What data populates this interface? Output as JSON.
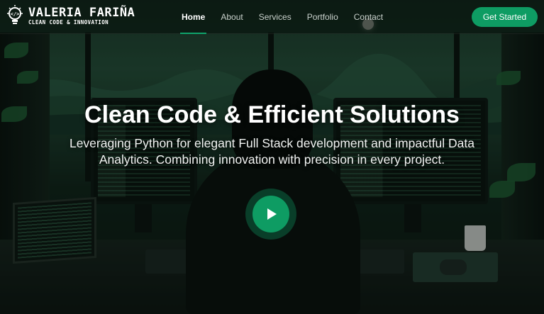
{
  "brand": {
    "name": "VALERIA FARIÑA",
    "tagline": "CLEAN CODE & INNOVATION",
    "logo_icon": "lightbulb-code-icon"
  },
  "nav": {
    "items": [
      {
        "label": "Home",
        "active": true
      },
      {
        "label": "About",
        "active": false
      },
      {
        "label": "Services",
        "active": false
      },
      {
        "label": "Portfolio",
        "active": false
      },
      {
        "label": "Contact",
        "active": false
      }
    ]
  },
  "header": {
    "cta_label": "Get Started"
  },
  "hero": {
    "title": "Clean Code & Efficient Solutions",
    "subtitle": "Leveraging Python for elegant Full Stack development and impactful Data Analytics. Combining innovation with precision in every project.",
    "play_icon": "play-icon"
  },
  "colors": {
    "accent": "#0e9c63",
    "header_bg": "#060e0a",
    "nav_text": "#c9d1cc"
  }
}
